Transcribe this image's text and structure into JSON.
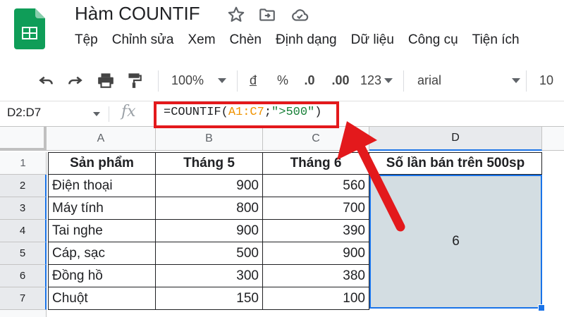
{
  "document": {
    "title": "Hàm COUNTIF",
    "icons": [
      "sheets-logo-icon",
      "star-icon",
      "move-to-folder-icon",
      "cloud-saved-icon"
    ]
  },
  "menu": {
    "items": [
      "Tệp",
      "Chỉnh sửa",
      "Xem",
      "Chèn",
      "Định dạng",
      "Dữ liệu",
      "Công cụ",
      "Tiện ích"
    ]
  },
  "toolbar": {
    "zoom": "100%",
    "currency": "đ",
    "percent": "%",
    "decrease_decimal": ".0",
    "increase_decimal": ".00",
    "number_format": "123",
    "font": "arial",
    "font_size": "10"
  },
  "formula_bar": {
    "name_box": "D2:D7",
    "fx": "fx",
    "formula": {
      "prefix": "=COUNTIF(",
      "range": "A1:C7",
      "separator": ";",
      "criteria": "\">500\"",
      "suffix": ")"
    }
  },
  "sheet": {
    "columns": [
      "A",
      "B",
      "C",
      "D"
    ],
    "rows": [
      "1",
      "2",
      "3",
      "4",
      "5",
      "6",
      "7"
    ],
    "header": [
      "Sản phẩm",
      "Tháng 5",
      "Tháng 6",
      "Số lần bán trên 500sp"
    ],
    "data": [
      [
        "Điện thoại",
        "900",
        "560"
      ],
      [
        "Máy tính",
        "800",
        "700"
      ],
      [
        "Tai nghe",
        "900",
        "390"
      ],
      [
        "Cáp, sạc",
        "500",
        "900"
      ],
      [
        "Đồng hồ",
        "300",
        "380"
      ],
      [
        "Chuột",
        "150",
        "100"
      ]
    ],
    "result": "6",
    "selected_column": "D",
    "selected_rows": [
      "2",
      "3",
      "4",
      "5",
      "6",
      "7"
    ]
  },
  "colors": {
    "highlight": "#e3191c",
    "selection": "#1a73e8",
    "selection_fill": "#d3dde2",
    "range_ref": "#f09300",
    "string_literal": "#188038"
  }
}
